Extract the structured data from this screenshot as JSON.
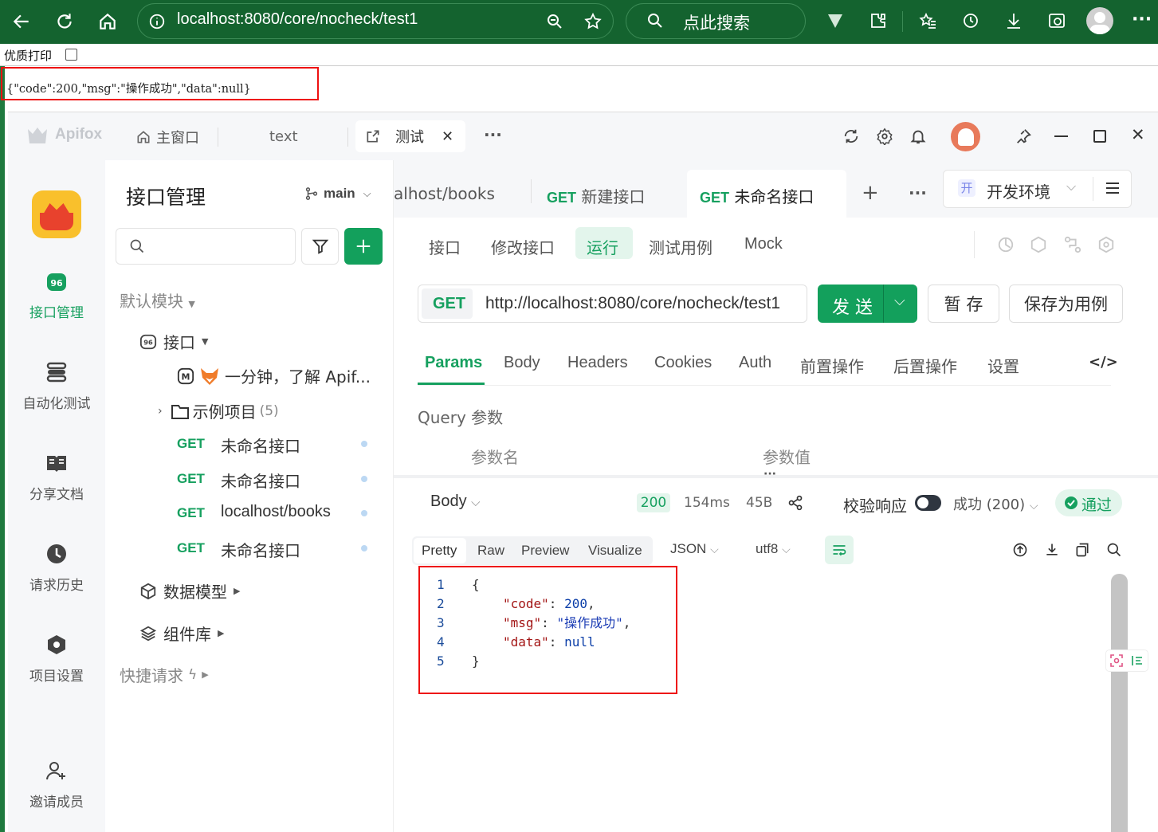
{
  "browser": {
    "url": "localhost:8080/core/nocheck/test1",
    "search_label": "点此搜索"
  },
  "page": {
    "print_label": "优质打印",
    "json_response": "{\"code\":200,\"msg\":\"操作成功\",\"data\":null}"
  },
  "apifox": {
    "logo_text": "Apifox",
    "tabs": [
      {
        "label": "主窗口"
      },
      {
        "label": "text"
      },
      {
        "label": "测试"
      }
    ],
    "nav": [
      {
        "label": "接口管理",
        "icon": "api-icon"
      },
      {
        "label": "自动化测试",
        "icon": "automation-icon"
      },
      {
        "label": "分享文档",
        "icon": "book-icon"
      },
      {
        "label": "请求历史",
        "icon": "clock-icon"
      },
      {
        "label": "项目设置",
        "icon": "settings-icon"
      },
      {
        "label": "邀请成员",
        "icon": "add-user-icon"
      }
    ],
    "panel": {
      "title": "接口管理",
      "branch": "main",
      "default_module": "默认模块",
      "api_folder": "接口",
      "intro_item": "一分钟，了解 Apif...",
      "example_folder": "示例项目",
      "example_count": "(5)",
      "endpoints": [
        {
          "method": "GET",
          "name": "未命名接口"
        },
        {
          "method": "GET",
          "name": "未命名接口"
        },
        {
          "method": "GET",
          "name": "localhost/books"
        },
        {
          "method": "GET",
          "name": "未命名接口"
        }
      ],
      "data_models": "数据模型",
      "components": "组件库",
      "quick_request": "快捷请求"
    },
    "main": {
      "doc_tabs": [
        {
          "method": "",
          "label": "alhost/books"
        },
        {
          "method": "GET",
          "label": "新建接口"
        },
        {
          "method": "GET",
          "label": "未命名接口"
        }
      ],
      "env_badge": "开",
      "env_label": "开发环境",
      "subtabs": [
        "接口",
        "修改接口",
        "运行",
        "测试用例",
        "Mock"
      ],
      "method": "GET",
      "url": "http://localhost:8080/core/nocheck/test1",
      "send_label": "发 送",
      "save_label": "暂 存",
      "save_case_label": "保存为用例",
      "param_tabs": [
        "Params",
        "Body",
        "Headers",
        "Cookies",
        "Auth",
        "前置操作",
        "后置操作",
        "设置"
      ],
      "query_title": "Query 参数",
      "col_name": "参数名",
      "col_value": "参数值",
      "resp_body_label": "Body",
      "status_code": "200",
      "time": "154ms",
      "size": "45B",
      "validate_label": "校验响应",
      "success_label": "成功 (200)",
      "pass_label": "通过",
      "view_tabs": [
        "Pretty",
        "Raw",
        "Preview",
        "Visualize"
      ],
      "format": "JSON",
      "encoding": "utf8",
      "code_lines": [
        {
          "n": "1",
          "text": "{"
        },
        {
          "n": "2",
          "key": "\"code\"",
          "sep": ": ",
          "val": "200",
          "end": ","
        },
        {
          "n": "3",
          "key": "\"msg\"",
          "sep": ": ",
          "val": "\"操作成功\"",
          "end": ","
        },
        {
          "n": "4",
          "key": "\"data\"",
          "sep": ": ",
          "val": "null",
          "end": ""
        },
        {
          "n": "5",
          "text": "}"
        }
      ]
    }
  }
}
